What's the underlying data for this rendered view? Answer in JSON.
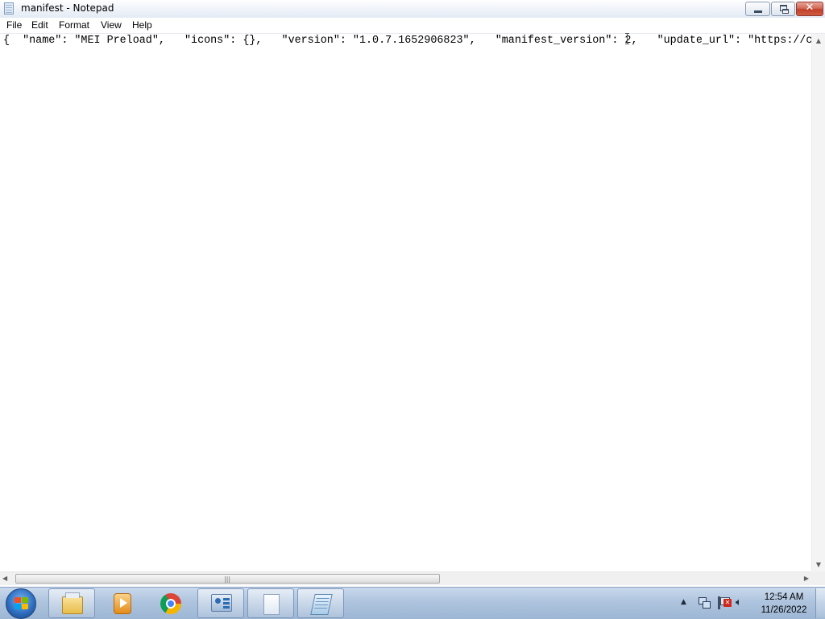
{
  "window": {
    "title": "manifest - Notepad",
    "close_symbol": "✕"
  },
  "menu": {
    "items": [
      "File",
      "Edit",
      "Format",
      "View",
      "Help"
    ]
  },
  "editor": {
    "text": "{  \"name\": \"MEI Preload\",   \"icons\": {},   \"version\": \"1.0.7.1652906823\",   \"manifest_version\": 2,   \"update_url\": \"https://c"
  },
  "taskbar": {
    "apps": [
      "explorer-icon",
      "media-icon",
      "chrome-icon",
      "control-panel-icon",
      "blank-doc-icon",
      "notepad-icon"
    ],
    "clock": {
      "time": "12:54 AM",
      "date": "11/26/2022"
    }
  },
  "colors": {
    "taskbar": "#aec4de",
    "close_button": "#c0402b"
  }
}
